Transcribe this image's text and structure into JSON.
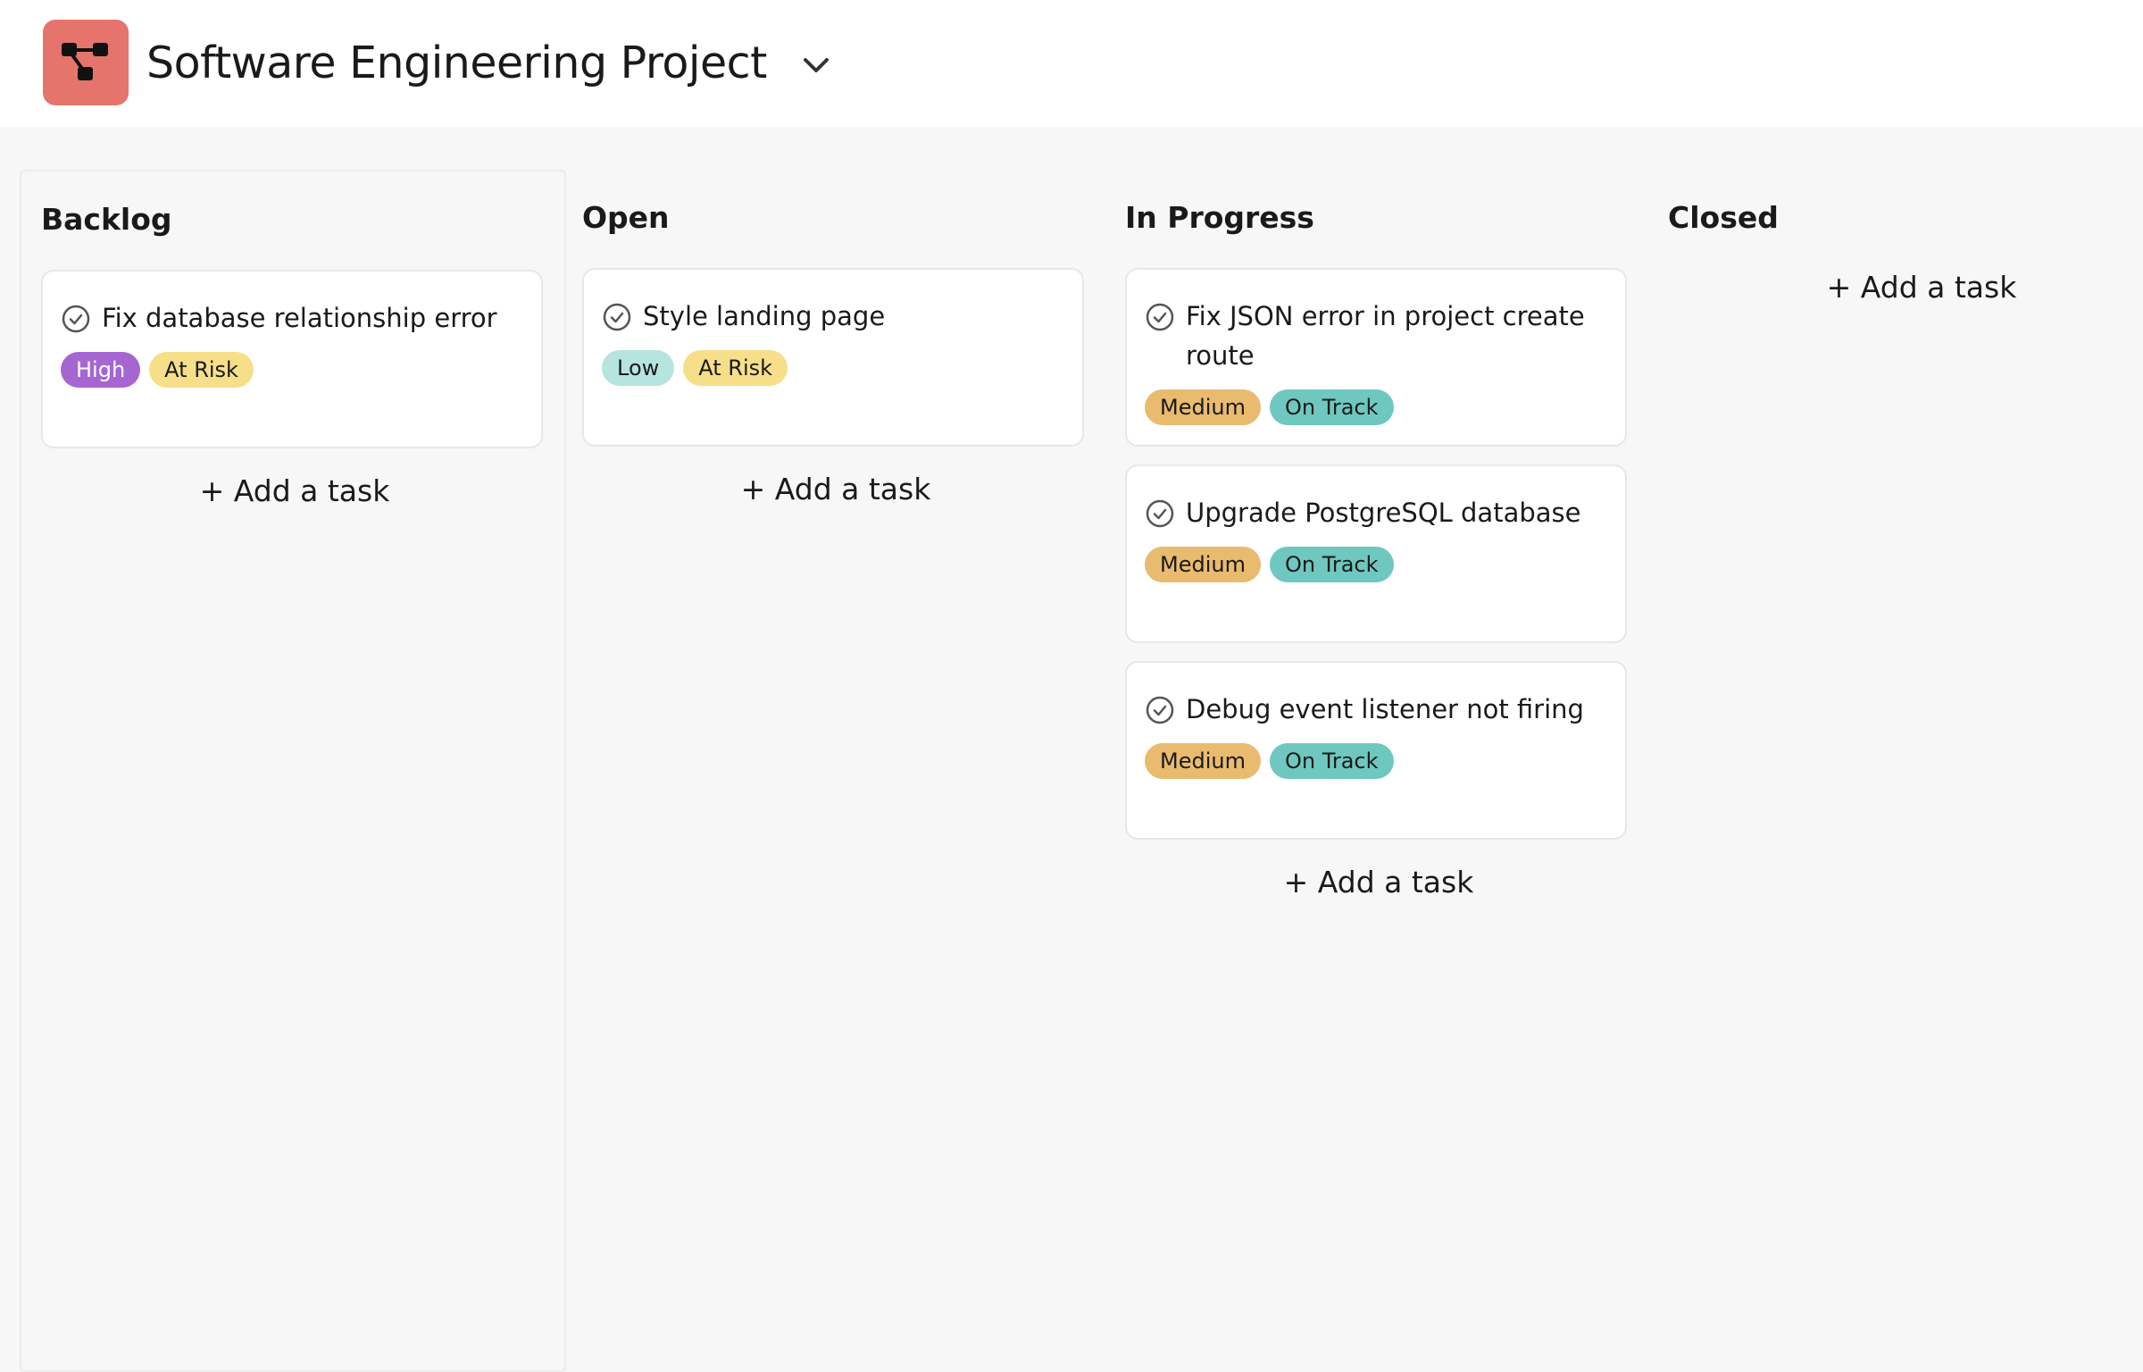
{
  "header": {
    "title": "Software Engineering Project",
    "logo_icon": "project-hierarchy-icon",
    "dropdown_icon": "chevron-down-icon"
  },
  "colors": {
    "logo_bg": "#e5746c",
    "high": "#a566d2",
    "low": "#b6e4e1",
    "medium": "#e8bb6f",
    "at_risk": "#f6df88",
    "on_track": "#6ec8bf"
  },
  "columns": [
    {
      "title": "Backlog",
      "add_label": "+ Add a task",
      "cards": [
        {
          "title": "Fix database relationship error",
          "priority": "High",
          "status": "At Risk"
        }
      ]
    },
    {
      "title": "Open",
      "add_label": "+ Add a task",
      "cards": [
        {
          "title": "Style landing page",
          "priority": "Low",
          "status": "At Risk"
        }
      ]
    },
    {
      "title": "In Progress",
      "add_label": "+ Add a task",
      "cards": [
        {
          "title": "Fix JSON error in project create route",
          "priority": "Medium",
          "status": "On Track"
        },
        {
          "title": "Upgrade PostgreSQL database",
          "priority": "Medium",
          "status": "On Track"
        },
        {
          "title": "Debug event listener not firing",
          "priority": "Medium",
          "status": "On Track"
        }
      ]
    },
    {
      "title": "Closed",
      "add_label": "+ Add a task",
      "cards": []
    }
  ]
}
